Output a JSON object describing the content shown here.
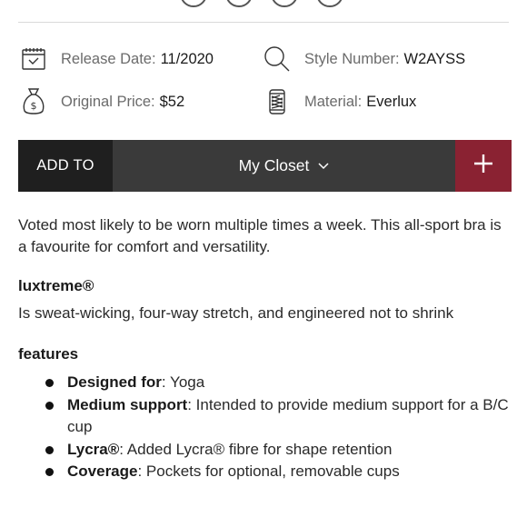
{
  "details": {
    "release": {
      "label": "Release Date:",
      "value": "11/2020",
      "icon": "calendar-icon"
    },
    "style": {
      "label": "Style Number:",
      "value": "W2AYSS",
      "icon": "search-icon"
    },
    "price": {
      "label": "Original Price:",
      "value": "$52",
      "icon": "money-bag-icon"
    },
    "material": {
      "label": "Material:",
      "value": "Everlux",
      "icon": "fabric-roll-icon"
    }
  },
  "closet_bar": {
    "add_to_label": "ADD TO",
    "selected": "My Closet",
    "plus_icon": "plus-icon",
    "colors": {
      "add_to_bg": "#1f1f1f",
      "select_bg": "#3a3a3a",
      "plus_bg": "#8a2232"
    }
  },
  "description": "Voted most likely to be worn multiple times a week. This all-sport bra is a favourite for comfort and versatility.",
  "luxtreme": {
    "heading": "luxtreme®",
    "text": "Is sweat-wicking, four-way stretch, and engineered not to shrink"
  },
  "features": {
    "heading": "features",
    "items": [
      {
        "name": "Designed for",
        "text": ": Yoga"
      },
      {
        "name": "Medium support",
        "text": ": Intended to provide medium support for a B/C cup"
      },
      {
        "name": "Lycra®",
        "text": ": Added Lycra® fibre for shape retention"
      },
      {
        "name": "Coverage",
        "text": ": Pockets for optional, removable cups"
      }
    ]
  }
}
